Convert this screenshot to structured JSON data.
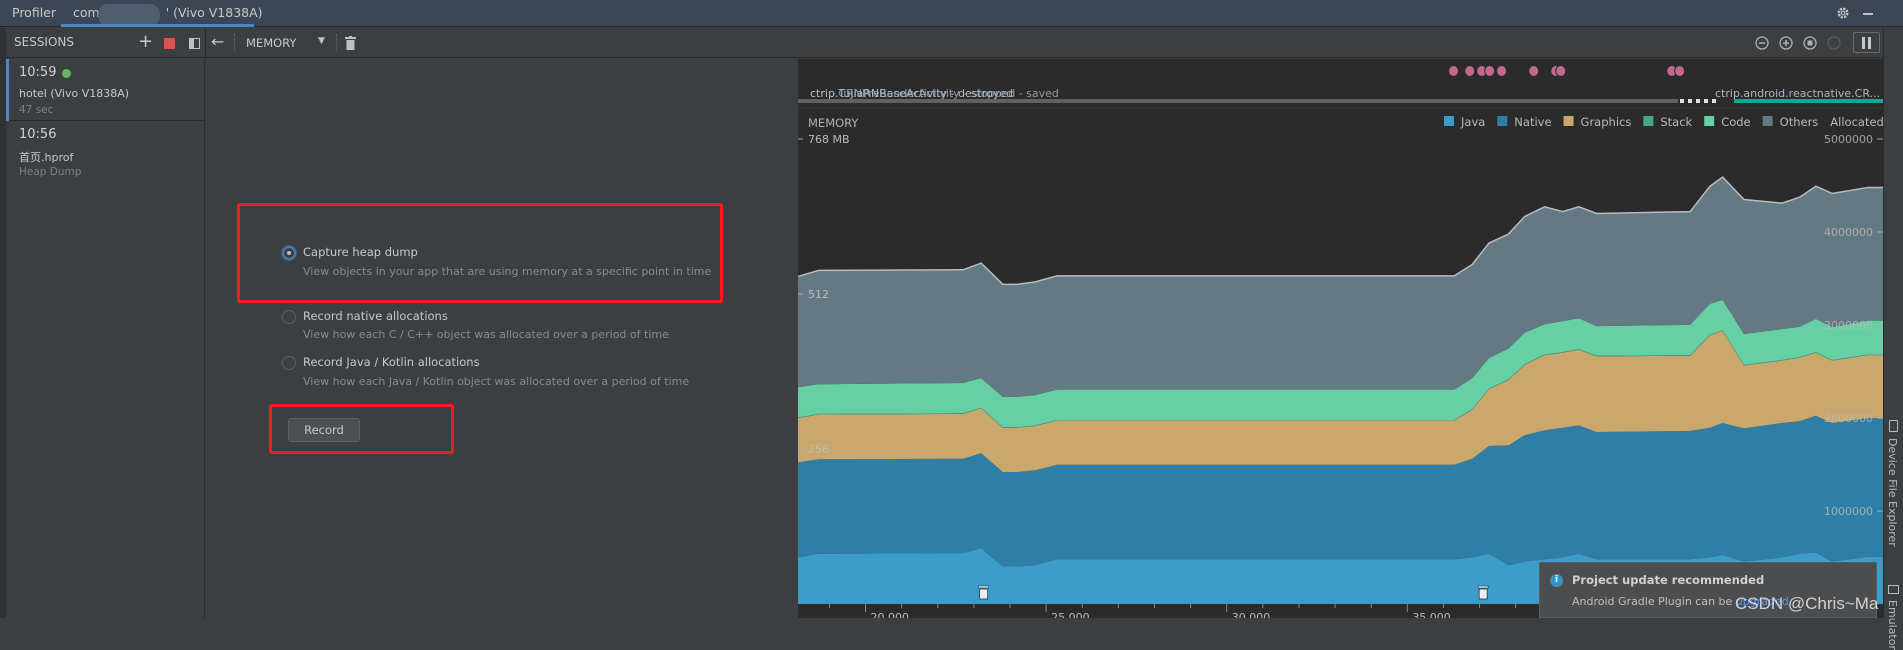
{
  "titlebar": {
    "app": "Profiler",
    "tab_prefix": "com",
    "tab_device": "' (Vivo V1838A)"
  },
  "toolbar": {
    "sessions_label": "SESSIONS",
    "profiler_select": "MEMORY"
  },
  "sessions": [
    {
      "time": "10:59",
      "name": "hotel (Vivo V1838A)",
      "sub": "47 sec",
      "live": true,
      "live_color": "#5fb85f"
    },
    {
      "time": "10:56",
      "name": "首页.hprof",
      "sub": "Heap Dump",
      "live": false
    }
  ],
  "options": [
    {
      "title": "Capture heap dump",
      "desc": "View objects in your app that are using memory at a specific point in time",
      "selected": true
    },
    {
      "title": "Record native allocations",
      "desc": "View how each C / C++ object was allocated over a period of time",
      "selected": false
    },
    {
      "title": "Record Java / Kotlin allocations",
      "desc": "View how each Java / Kotlin object was allocated over a period of time",
      "selected": false
    }
  ],
  "record_label": "Record",
  "activity": {
    "labels": [
      "ctrip.TujiaRNBaseActivity - destroyed",
      "ctrip.CRNPreRenderActivity - stopped - saved",
      "ctrip.android.reactnative.CR..."
    ],
    "event_color": "#c4698e",
    "active_color": "#12a896"
  },
  "chart_data": {
    "type": "area",
    "stacked": true,
    "title": "MEMORY",
    "x_unit": "s",
    "xlim": [
      18.13,
      48.17
    ],
    "x_ticks": [
      "20.000",
      "25.000",
      "30.000",
      "35.000"
    ],
    "x_tick_values": [
      20,
      25,
      30,
      35
    ],
    "ylim": [
      0,
      768
    ],
    "y_ticks": [
      {
        "value": 768,
        "label": "768 MB"
      },
      {
        "value": 512,
        "label": "512"
      },
      {
        "value": 256,
        "label": "256"
      }
    ],
    "y2lim": [
      0,
      5000000
    ],
    "y2_ticks": [
      "5000000",
      "4000000",
      "3000000",
      "2000000",
      "1000000"
    ],
    "y2_tick_values": [
      5000000,
      4000000,
      3000000,
      2000000,
      1000000
    ],
    "legend": [
      "Java",
      "Native",
      "Graphics",
      "Stack",
      "Code",
      "Others",
      "Allocated"
    ],
    "legend_position": "top-right",
    "x": [
      18.13,
      18.7,
      22.7,
      23.2,
      23.8,
      24.2,
      24.7,
      25.3,
      36.3,
      36.8,
      37.26,
      37.8,
      38.25,
      38.8,
      39.3,
      39.75,
      40.24,
      42.83,
      43.38,
      43.73,
      44.32,
      45.37,
      45.87,
      46.31,
      46.76,
      47.76,
      48.17
    ],
    "series": [
      {
        "name": "Java",
        "color": "#3d9dca",
        "values": [
          77,
          83,
          84,
          92,
          62,
          62,
          64,
          74,
          74,
          77,
          83,
          64,
          70,
          74,
          77,
          83,
          74,
          74,
          77,
          81,
          70,
          77,
          83,
          85,
          70,
          78,
          78
        ]
      },
      {
        "name": "Native",
        "color": "#2f7ea6",
        "values": [
          157,
          156,
          156,
          157,
          156,
          156,
          157,
          156,
          156,
          163,
          178,
          198,
          209,
          213,
          214,
          212,
          210,
          212,
          214,
          218,
          220,
          222,
          219,
          226,
          229,
          229,
          229
        ]
      },
      {
        "name": "Graphics",
        "color": "#c9a76d",
        "values": [
          73,
          74,
          74,
          74,
          73,
          73,
          73,
          73,
          73,
          81,
          94,
          108,
          116,
          124,
          124,
          125,
          125,
          124,
          153,
          152,
          104,
          103,
          105,
          104,
          103,
          104,
          104
        ]
      },
      {
        "name": "Stack",
        "color": "#48a884",
        "values": [
          1,
          1,
          1,
          1,
          1,
          1,
          1,
          1,
          1,
          1,
          1,
          1,
          1,
          1,
          1,
          1,
          1,
          1,
          1,
          1,
          1,
          1,
          1,
          1,
          1,
          1,
          1
        ]
      },
      {
        "name": "Code",
        "color": "#66cfa3",
        "values": [
          50,
          49,
          50,
          49,
          50,
          50,
          50,
          50,
          50,
          51,
          50,
          51,
          52,
          50,
          51,
          51,
          49,
          50,
          51,
          50,
          51,
          51,
          50,
          55,
          54,
          56,
          56
        ]
      },
      {
        "name": "Others",
        "color": "#637983",
        "values": [
          183,
          188,
          187,
          190,
          186,
          186,
          187,
          188,
          188,
          188,
          190,
          189,
          192,
          194,
          181,
          184,
          186,
          187,
          194,
          203,
          222,
          208,
          214,
          219,
          221,
          220,
          220
        ]
      }
    ],
    "gc_events": [
      23.27,
      37.1
    ],
    "user_events": [
      36.28,
      36.73,
      37.06,
      37.28,
      37.61,
      38.5,
      39.11,
      39.25,
      42.32,
      42.54
    ]
  },
  "side_tools": [
    "Device File Explorer",
    "Emulator"
  ],
  "toast": {
    "title": "Project update recommended",
    "body": "Android Gradle Plugin can be ",
    "link": "upgraded."
  },
  "watermark": "CSDN @Chris~Ma"
}
